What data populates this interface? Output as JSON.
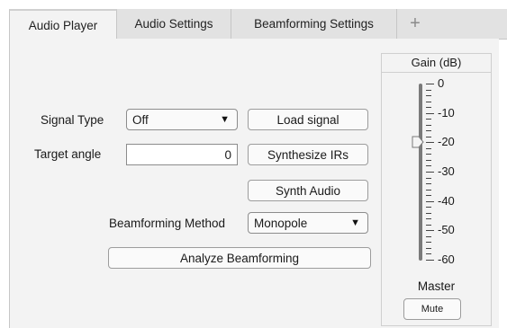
{
  "tabs": [
    {
      "label": "Audio Player",
      "active": true
    },
    {
      "label": "Audio Settings",
      "active": false
    },
    {
      "label": "Beamforming Settings",
      "active": false
    },
    {
      "label": "+",
      "active": false
    }
  ],
  "controls": {
    "signal_type_label": "Signal Type",
    "signal_type_value": "Off",
    "target_angle_label": "Target angle",
    "target_angle_value": "0",
    "load_signal_label": "Load signal",
    "synthesize_irs_label": "Synthesize IRs",
    "synth_audio_label": "Synth Audio",
    "beamforming_method_label": "Beamforming Method",
    "beamforming_method_value": "Monopole",
    "analyze_label": "Analyze Beamforming"
  },
  "gain": {
    "title": "Gain (dB)",
    "ticks": [
      "0",
      "-10",
      "-20",
      "-30",
      "-40",
      "-50",
      "-60"
    ],
    "value_db": -20,
    "min_db": -60,
    "max_db": 0,
    "master_label": "Master",
    "mute_label": "Mute"
  }
}
